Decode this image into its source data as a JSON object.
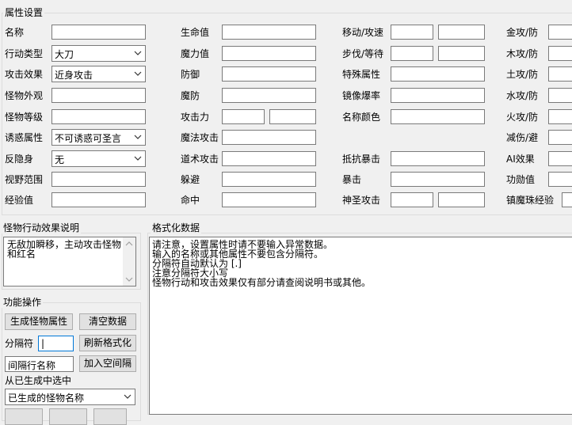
{
  "attr_group": {
    "title": "属性设置"
  },
  "col1": [
    {
      "label": "名称",
      "value": ""
    },
    {
      "label": "行动类型",
      "value": "大刀",
      "combo": true
    },
    {
      "label": "攻击效果",
      "value": "近身攻击",
      "combo": true
    },
    {
      "label": "怪物外观",
      "value": ""
    },
    {
      "label": "怪物等级",
      "value": ""
    },
    {
      "label": "诱惑属性",
      "value": "不可诱惑可圣言",
      "combo": true
    },
    {
      "label": "反隐身",
      "value": "无",
      "combo": true
    },
    {
      "label": "视野范围",
      "value": ""
    },
    {
      "label": "经验值",
      "value": ""
    }
  ],
  "col2": [
    {
      "label": "生命值"
    },
    {
      "label": "魔力值"
    },
    {
      "label": "防御"
    },
    {
      "label": "魔防"
    },
    {
      "label": "攻击力"
    },
    {
      "label": "魔法攻击"
    },
    {
      "label": "道术攻击"
    },
    {
      "label": "躲避"
    },
    {
      "label": "命中"
    }
  ],
  "col3": [
    {
      "label": "移动/攻速"
    },
    {
      "label": "步伐/等待"
    },
    {
      "label": "特殊属性"
    },
    {
      "label": "镜像爆率"
    },
    {
      "label": "名称颜色"
    },
    {
      "label": ""
    },
    {
      "label": "抵抗暴击"
    },
    {
      "label": "暴击"
    },
    {
      "label": "神圣攻击"
    }
  ],
  "col4": [
    {
      "label": "金攻/防"
    },
    {
      "label": "木攻/防"
    },
    {
      "label": "土攻/防"
    },
    {
      "label": "水攻/防"
    },
    {
      "label": "火攻/防"
    },
    {
      "label": "减伤/避"
    },
    {
      "label": "AI效果"
    },
    {
      "label": "功勋值"
    },
    {
      "label": "镇魔珠经验"
    }
  ],
  "desc_group": {
    "title": "怪物行动效果说明",
    "lines": [
      "无敌加瞬移，主动攻击怪物",
      "和红名"
    ]
  },
  "format_group": {
    "title": "格式化数据",
    "lines": [
      "请注意，设置属性时请不要输入异常数据。",
      "输入的名称或其他属性不要包含分隔符。",
      "分隔符自动默认为 [.]",
      "注意分隔符大小写",
      "怪物行动和攻击效果仅有部分请查阅说明书或其他。"
    ]
  },
  "func_group": {
    "title": "功能操作",
    "generate_btn": "生成怪物属性",
    "clear_btn": "清空数据",
    "separator_label": "分隔符",
    "separator_value": "|",
    "refresh_btn": "刷新格式化",
    "interval_name_value": "间隔行名称",
    "add_blank_btn": "加入空间隔",
    "select_label": "从已生成中选中",
    "select_value": "已生成的怪物名称"
  }
}
